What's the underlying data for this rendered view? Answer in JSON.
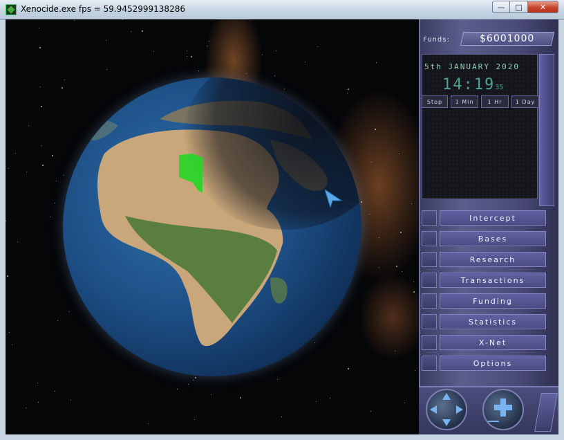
{
  "window": {
    "title": "Xenocide.exe  fps = 59.9452999138286",
    "minimize": "—",
    "maximize": "□",
    "close": "✕"
  },
  "hud": {
    "funds_label": "Funds:",
    "funds_value": "$6001000",
    "date": "5th JANUARY 2020",
    "time_hm": "14:19",
    "time_sec": "35",
    "speed_buttons": [
      "Stop",
      "1 Min",
      "1 Hr",
      "1 Day"
    ]
  },
  "menu": [
    "Intercept",
    "Bases",
    "Research",
    "Transactions",
    "Funding",
    "Statistics",
    "X-Net",
    "Options"
  ],
  "icons": {
    "app": "xenocide-app-icon",
    "globe": "earth-globe",
    "cursor": "pointer-cursor-icon",
    "nav": "globe-rotate-icon",
    "zoom": "zoom-in-icon"
  },
  "colors": {
    "panel": "#4a4b78",
    "button": "#5f62a0",
    "clock_text": "#4fa593",
    "highlight": "#2bd42b"
  }
}
